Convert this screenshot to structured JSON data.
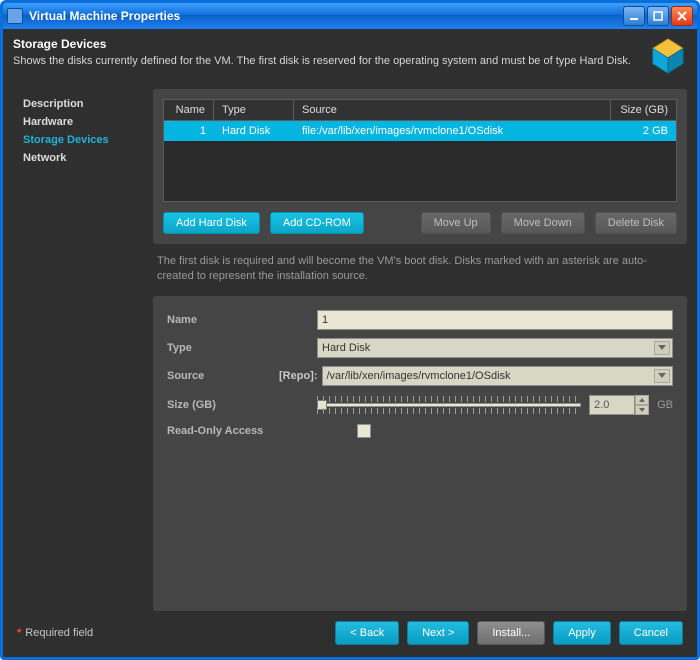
{
  "window": {
    "title": "Virtual Machine Properties"
  },
  "header": {
    "title": "Storage Devices",
    "description": "Shows the disks currently defined for the VM. The first disk is reserved for the operating system and must be of type Hard Disk."
  },
  "sidebar": {
    "items": [
      {
        "label": "Description"
      },
      {
        "label": "Hardware"
      },
      {
        "label": "Storage Devices"
      },
      {
        "label": "Network"
      }
    ],
    "active_index": 2
  },
  "table": {
    "columns": {
      "name": "Name",
      "type": "Type",
      "source": "Source",
      "size": "Size (GB)"
    },
    "rows": [
      {
        "name": "1",
        "type": "Hard Disk",
        "source": "file:/var/lib/xen/images/rvmclone1/OSdisk",
        "size": "2 GB"
      }
    ]
  },
  "table_buttons": {
    "add_hd": "Add Hard Disk",
    "add_cd": "Add CD-ROM",
    "move_up": "Move Up",
    "move_down": "Move Down",
    "delete": "Delete Disk"
  },
  "table_hint": "The first disk is required and will become the VM's boot disk. Disks marked with an asterisk are auto-created to represent the installation source.",
  "form": {
    "labels": {
      "name": "Name",
      "type": "Type",
      "source": "Source",
      "size": "Size (GB)",
      "readonly": "Read-Only Access"
    },
    "repo_marker": "[Repo]:",
    "values": {
      "name": "1",
      "type": "Hard Disk",
      "source": "/var/lib/xen/images/rvmclone1/OSdisk",
      "size": "2.0",
      "size_unit": "GB"
    }
  },
  "footer": {
    "required_label": "Required field",
    "buttons": {
      "back": "< Back",
      "next": "Next >",
      "install": "Install...",
      "apply": "Apply",
      "cancel": "Cancel"
    }
  }
}
